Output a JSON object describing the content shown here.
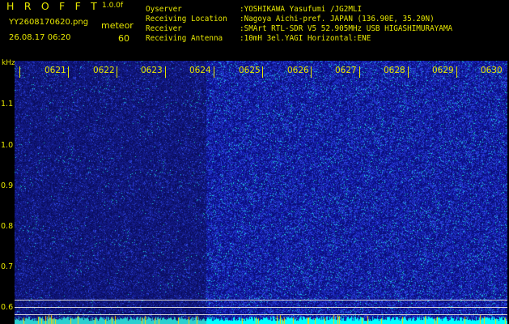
{
  "header": {
    "title": "H R O F F T",
    "version": "1.0.0f",
    "filename": "YY2608170620.png",
    "mode": "meteor",
    "datetime": "26.08.17 06:20",
    "count": "60"
  },
  "info": [
    {
      "key": "Oyserver",
      "value": ":YOSHIKAWA Yasufumi /JG2MLI"
    },
    {
      "key": "Receiving Location",
      "value": ":Nagoya Aichi-pref. JAPAN (136.90E, 35.20N)"
    },
    {
      "key": "Receiver",
      "value": ":SMArt RTL-SDR V5 52.905MHz USB HIGASHIMURAYAMA"
    },
    {
      "key": "Receiving Antenna",
      "value": ":10mH 3el.YAGI Horizontal:ENE"
    }
  ],
  "y_axis": {
    "unit": "kHz",
    "ticks": [
      "1.1",
      "1.0",
      "0.9",
      "0.8",
      "0.7",
      "0.6"
    ]
  },
  "x_axis": {
    "ticks": [
      "0621",
      "0622",
      "0623",
      "0624",
      "0625",
      "0626",
      "0627",
      "0628",
      "0629",
      "0630"
    ]
  },
  "colors": {
    "label": "#e6e600",
    "background": "#000000",
    "noise_low": "#1a1a8c",
    "noise_high": "#2f3fcf",
    "speckle": "#00ffff"
  }
}
